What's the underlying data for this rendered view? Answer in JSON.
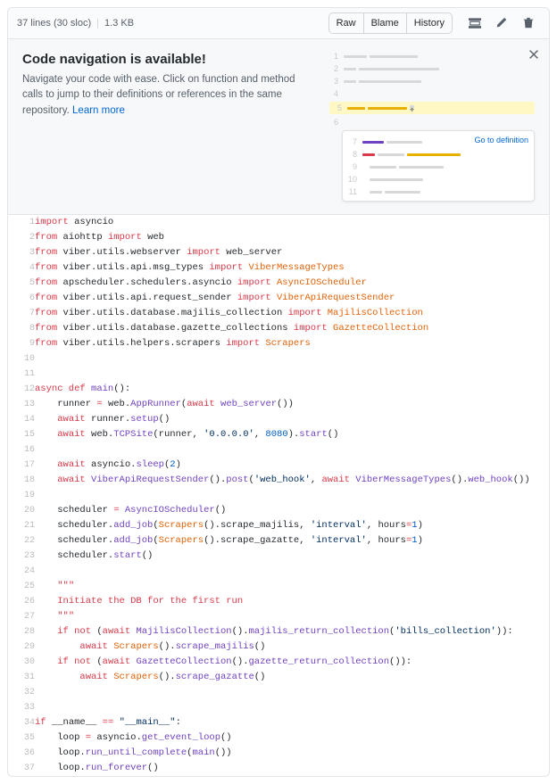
{
  "header": {
    "lines_summary": "37 lines (30 sloc)",
    "size": "1.3 KB",
    "raw": "Raw",
    "blame": "Blame",
    "history": "History"
  },
  "banner": {
    "title": "Code navigation is available!",
    "desc_pre": "Navigate your code with ease. Click on function and method calls to jump to their definitions or references in the same repository. ",
    "learn_more": "Learn more",
    "go_to_def": "Go to definition"
  },
  "illust": {
    "nums": [
      "1",
      "2",
      "3",
      "4",
      "5",
      "6",
      "7",
      "8",
      "9",
      "10",
      "11"
    ]
  },
  "code": [
    {
      "n": 1,
      "t": [
        [
          "k",
          "import"
        ],
        [
          "",
          " "
        ],
        [
          "nn",
          "asyncio"
        ]
      ]
    },
    {
      "n": 2,
      "t": [
        [
          "k",
          "from"
        ],
        [
          "",
          " "
        ],
        [
          "nn",
          "aiohttp"
        ],
        [
          "",
          " "
        ],
        [
          "k",
          "import"
        ],
        [
          "",
          " "
        ],
        [
          "nn",
          "web"
        ]
      ]
    },
    {
      "n": 3,
      "t": [
        [
          "k",
          "from"
        ],
        [
          "",
          " "
        ],
        [
          "nn",
          "viber.utils.webserver"
        ],
        [
          "",
          " "
        ],
        [
          "k",
          "import"
        ],
        [
          "",
          " "
        ],
        [
          "nn",
          "web_server"
        ]
      ]
    },
    {
      "n": 4,
      "t": [
        [
          "k",
          "from"
        ],
        [
          "",
          " "
        ],
        [
          "nn",
          "viber.utils.api.msg_types"
        ],
        [
          "",
          " "
        ],
        [
          "k",
          "import"
        ],
        [
          "",
          " "
        ],
        [
          "nc",
          "ViberMessageTypes"
        ]
      ]
    },
    {
      "n": 5,
      "t": [
        [
          "k",
          "from"
        ],
        [
          "",
          " "
        ],
        [
          "nn",
          "apscheduler.schedulers.asyncio"
        ],
        [
          "",
          " "
        ],
        [
          "k",
          "import"
        ],
        [
          "",
          " "
        ],
        [
          "nc",
          "AsyncIOScheduler"
        ]
      ]
    },
    {
      "n": 6,
      "t": [
        [
          "k",
          "from"
        ],
        [
          "",
          " "
        ],
        [
          "nn",
          "viber.utils.api.request_sender"
        ],
        [
          "",
          " "
        ],
        [
          "k",
          "import"
        ],
        [
          "",
          " "
        ],
        [
          "nc",
          "ViberApiRequestSender"
        ]
      ]
    },
    {
      "n": 7,
      "t": [
        [
          "k",
          "from"
        ],
        [
          "",
          " "
        ],
        [
          "nn",
          "viber.utils.database.majilis_collection"
        ],
        [
          "",
          " "
        ],
        [
          "k",
          "import"
        ],
        [
          "",
          " "
        ],
        [
          "nc",
          "MajilisCollection"
        ]
      ]
    },
    {
      "n": 8,
      "t": [
        [
          "k",
          "from"
        ],
        [
          "",
          " "
        ],
        [
          "nn",
          "viber.utils.database.gazette_collections"
        ],
        [
          "",
          " "
        ],
        [
          "k",
          "import"
        ],
        [
          "",
          " "
        ],
        [
          "nc",
          "GazetteCollection"
        ]
      ]
    },
    {
      "n": 9,
      "t": [
        [
          "k",
          "from"
        ],
        [
          "",
          " "
        ],
        [
          "nn",
          "viber.utils.helpers.scrapers"
        ],
        [
          "",
          " "
        ],
        [
          "k",
          "import"
        ],
        [
          "",
          " "
        ],
        [
          "nc",
          "Scrapers"
        ]
      ]
    },
    {
      "n": 10,
      "t": [
        [
          "",
          ""
        ]
      ]
    },
    {
      "n": 11,
      "t": [
        [
          "",
          ""
        ]
      ]
    },
    {
      "n": 12,
      "t": [
        [
          "k",
          "async def"
        ],
        [
          "",
          " "
        ],
        [
          "nf",
          "main"
        ],
        [
          "nn",
          "():"
        ]
      ]
    },
    {
      "n": 13,
      "t": [
        [
          "",
          "    "
        ],
        [
          "nn",
          "runner "
        ],
        [
          "k",
          "="
        ],
        [
          "",
          " "
        ],
        [
          "nn",
          "web."
        ],
        [
          "nf",
          "AppRunner"
        ],
        [
          "nn",
          "("
        ],
        [
          "k",
          "await"
        ],
        [
          "",
          " "
        ],
        [
          "nf",
          "web_server"
        ],
        [
          "nn",
          "())"
        ]
      ]
    },
    {
      "n": 14,
      "t": [
        [
          "",
          "    "
        ],
        [
          "k",
          "await"
        ],
        [
          "",
          " "
        ],
        [
          "nn",
          "runner."
        ],
        [
          "nf",
          "setup"
        ],
        [
          "nn",
          "()"
        ]
      ]
    },
    {
      "n": 15,
      "t": [
        [
          "",
          "    "
        ],
        [
          "k",
          "await"
        ],
        [
          "",
          " "
        ],
        [
          "nn",
          "web."
        ],
        [
          "nf",
          "TCPSite"
        ],
        [
          "nn",
          "(runner, "
        ],
        [
          "s",
          "'0.0.0.0'"
        ],
        [
          "nn",
          ", "
        ],
        [
          "mi",
          "8080"
        ],
        [
          "nn",
          ")."
        ],
        [
          "nf",
          "start"
        ],
        [
          "nn",
          "()"
        ]
      ]
    },
    {
      "n": 16,
      "t": [
        [
          "",
          ""
        ]
      ]
    },
    {
      "n": 17,
      "t": [
        [
          "",
          "    "
        ],
        [
          "k",
          "await"
        ],
        [
          "",
          " "
        ],
        [
          "nn",
          "asyncio."
        ],
        [
          "nf",
          "sleep"
        ],
        [
          "nn",
          "("
        ],
        [
          "mi",
          "2"
        ],
        [
          "nn",
          ")"
        ]
      ]
    },
    {
      "n": 18,
      "t": [
        [
          "",
          "    "
        ],
        [
          "k",
          "await"
        ],
        [
          "",
          " "
        ],
        [
          "nf",
          "ViberApiRequestSender"
        ],
        [
          "nn",
          "()."
        ],
        [
          "nf",
          "post"
        ],
        [
          "nn",
          "("
        ],
        [
          "s",
          "'web_hook'"
        ],
        [
          "nn",
          ", "
        ],
        [
          "k",
          "await"
        ],
        [
          "",
          " "
        ],
        [
          "nf",
          "ViberMessageTypes"
        ],
        [
          "nn",
          "()."
        ],
        [
          "nf",
          "web_hook"
        ],
        [
          "nn",
          "())"
        ]
      ]
    },
    {
      "n": 19,
      "t": [
        [
          "",
          ""
        ]
      ]
    },
    {
      "n": 20,
      "t": [
        [
          "",
          "    "
        ],
        [
          "nn",
          "scheduler "
        ],
        [
          "k",
          "="
        ],
        [
          "",
          " "
        ],
        [
          "nf",
          "AsyncIOScheduler"
        ],
        [
          "nn",
          "()"
        ]
      ]
    },
    {
      "n": 21,
      "t": [
        [
          "",
          "    "
        ],
        [
          "nn",
          "scheduler."
        ],
        [
          "nf",
          "add_job"
        ],
        [
          "nn",
          "("
        ],
        [
          "nc",
          "Scrapers"
        ],
        [
          "nn",
          "().scrape_majilis, "
        ],
        [
          "s",
          "'interval'"
        ],
        [
          "nn",
          ", "
        ],
        [
          "nn",
          "hours"
        ],
        [
          "k",
          "="
        ],
        [
          "mi",
          "1"
        ],
        [
          "nn",
          ")"
        ]
      ]
    },
    {
      "n": 22,
      "t": [
        [
          "",
          "    "
        ],
        [
          "nn",
          "scheduler."
        ],
        [
          "nf",
          "add_job"
        ],
        [
          "nn",
          "("
        ],
        [
          "nc",
          "Scrapers"
        ],
        [
          "nn",
          "().scrape_gazatte, "
        ],
        [
          "s",
          "'interval'"
        ],
        [
          "nn",
          ", "
        ],
        [
          "nn",
          "hours"
        ],
        [
          "k",
          "="
        ],
        [
          "mi",
          "1"
        ],
        [
          "nn",
          ")"
        ]
      ]
    },
    {
      "n": 23,
      "t": [
        [
          "",
          "    "
        ],
        [
          "nn",
          "scheduler."
        ],
        [
          "nf",
          "start"
        ],
        [
          "nn",
          "()"
        ]
      ]
    },
    {
      "n": 24,
      "t": [
        [
          "",
          ""
        ]
      ]
    },
    {
      "n": 25,
      "t": [
        [
          "",
          "    "
        ],
        [
          "sd",
          "\"\"\""
        ]
      ]
    },
    {
      "n": 26,
      "t": [
        [
          "",
          "    "
        ],
        [
          "sd",
          "Initiate the DB for the first run"
        ]
      ]
    },
    {
      "n": 27,
      "t": [
        [
          "",
          "    "
        ],
        [
          "sd",
          "\"\"\""
        ]
      ]
    },
    {
      "n": 28,
      "t": [
        [
          "",
          "    "
        ],
        [
          "k",
          "if not"
        ],
        [
          "",
          " ("
        ],
        [
          "k",
          "await"
        ],
        [
          "",
          " "
        ],
        [
          "nf",
          "MajilisCollection"
        ],
        [
          "nn",
          "()."
        ],
        [
          "nf",
          "majilis_return_collection"
        ],
        [
          "nn",
          "("
        ],
        [
          "s",
          "'bills_collection'"
        ],
        [
          "nn",
          ")):"
        ]
      ]
    },
    {
      "n": 29,
      "t": [
        [
          "",
          "        "
        ],
        [
          "k",
          "await"
        ],
        [
          "",
          " "
        ],
        [
          "nc",
          "Scrapers"
        ],
        [
          "nn",
          "()."
        ],
        [
          "nf",
          "scrape_majilis"
        ],
        [
          "nn",
          "()"
        ]
      ]
    },
    {
      "n": 30,
      "t": [
        [
          "",
          "    "
        ],
        [
          "k",
          "if not"
        ],
        [
          "",
          " ("
        ],
        [
          "k",
          "await"
        ],
        [
          "",
          " "
        ],
        [
          "nf",
          "GazetteCollection"
        ],
        [
          "nn",
          "()."
        ],
        [
          "nf",
          "gazette_return_collection"
        ],
        [
          "nn",
          "()):"
        ]
      ]
    },
    {
      "n": 31,
      "t": [
        [
          "",
          "        "
        ],
        [
          "k",
          "await"
        ],
        [
          "",
          " "
        ],
        [
          "nc",
          "Scrapers"
        ],
        [
          "nn",
          "()."
        ],
        [
          "nf",
          "scrape_gazatte"
        ],
        [
          "nn",
          "()"
        ]
      ]
    },
    {
      "n": 32,
      "t": [
        [
          "",
          ""
        ]
      ]
    },
    {
      "n": 33,
      "t": [
        [
          "",
          ""
        ]
      ]
    },
    {
      "n": 34,
      "t": [
        [
          "k",
          "if"
        ],
        [
          "",
          " "
        ],
        [
          "nn",
          "__name__ "
        ],
        [
          "k",
          "=="
        ],
        [
          "",
          " "
        ],
        [
          "s",
          "\"__main__\""
        ],
        [
          "nn",
          ":"
        ]
      ]
    },
    {
      "n": 35,
      "t": [
        [
          "",
          "    "
        ],
        [
          "nn",
          "loop "
        ],
        [
          "k",
          "="
        ],
        [
          "",
          " "
        ],
        [
          "nn",
          "asyncio."
        ],
        [
          "nf",
          "get_event_loop"
        ],
        [
          "nn",
          "()"
        ]
      ]
    },
    {
      "n": 36,
      "t": [
        [
          "",
          "    "
        ],
        [
          "nn",
          "loop."
        ],
        [
          "nf",
          "run_until_complete"
        ],
        [
          "nn",
          "("
        ],
        [
          "nf",
          "main"
        ],
        [
          "nn",
          "())"
        ]
      ]
    },
    {
      "n": 37,
      "t": [
        [
          "",
          "    "
        ],
        [
          "nn",
          "loop."
        ],
        [
          "nf",
          "run_forever"
        ],
        [
          "nn",
          "()"
        ]
      ]
    }
  ]
}
